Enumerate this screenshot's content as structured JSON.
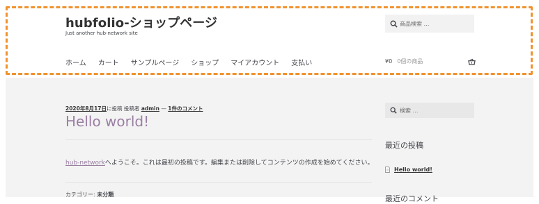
{
  "header": {
    "site_title": "hubfolio-ショップページ",
    "site_description": "Just another hub-network site",
    "search_placeholder": "商品検索 …",
    "nav": [
      "ホーム",
      "カート",
      "サンプルページ",
      "ショップ",
      "マイアカウント",
      "支払い"
    ],
    "cart_amount": "¥0",
    "cart_count": "0個の商品"
  },
  "post": {
    "date": "2020年8月17日",
    "posted_in": "に投稿",
    "author_prefix": "投稿者",
    "author": "admin",
    "separator": "—",
    "comments": "1件のコメント",
    "title": "Hello world!",
    "content_link": "hub-network",
    "content_text": "へようこそ。これは最初の投稿です。編集または削除してコンテンツの作成を始めてください。",
    "category_label": "カテゴリー:",
    "category_value": "未分類"
  },
  "sidebar": {
    "search_placeholder": "検索 …",
    "recent_heading": "最近の投稿",
    "recent_posts": [
      "Hello world!"
    ],
    "comments_heading": "最近のコメント"
  },
  "colors": {
    "highlight": "#f0922e",
    "accent": "#9a7fa3",
    "main_bg": "#f3f3f3"
  }
}
